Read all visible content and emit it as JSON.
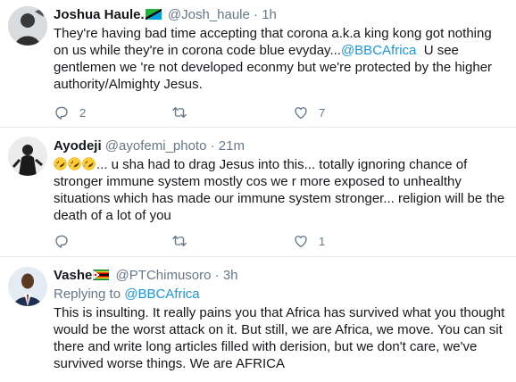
{
  "tweets": [
    {
      "name": "Joshua Haule.",
      "handle": "@Josh_haule",
      "dot": "·",
      "time": "1h",
      "lines": [
        "They're having bad time accepting that corona a.k.a king kong got nothing",
        "on us while they're in corona code blue evyday...",
        "gentlemen we 're not developed econmy but we're protected by the higher",
        "authority/Almighty Jesus."
      ],
      "mention": "@BBCAfrica",
      "line2_tail": "  U see",
      "reply_count": "2",
      "retweet_count": "",
      "like_count": "7"
    },
    {
      "name": "Ayodeji",
      "handle": "@ayofemi_photo",
      "dot": "·",
      "time": "21m",
      "emoji_prefix_text": "... u sha had to drag Jesus into this... totally ignoring chance of",
      "lines": [
        "stronger immune system mostly cos we r more exposed to unhealthy",
        "situations which has made our immune system stronger... religion will be the",
        "death of a lot of you"
      ],
      "reply_count": "",
      "retweet_count": "",
      "like_count": "1"
    },
    {
      "name": "Vashe",
      "handle": "@PTChimusoro",
      "dot": "·",
      "time": "3h",
      "replying_label": "Replying to",
      "replying_to": "@BBCAfrica",
      "lines": [
        "This is insulting. It really pains you that Africa has survived what you thought",
        "would be the worst attack on it. But still, we are Africa, we move. You can sit",
        "there and write long articles filled with derision, but we don't care, we've",
        "survived worse things. We are AFRICA"
      ]
    }
  ],
  "colors": {
    "link": "#1b95e0",
    "muted": "#657786",
    "text": "#14171a",
    "divider": "#e6ecf0"
  },
  "icons": [
    "reply-icon",
    "retweet-icon",
    "like-icon",
    "rolling-laughing-emoji",
    "tanzania-flag-icon",
    "zimbabwe-flag-icon"
  ]
}
